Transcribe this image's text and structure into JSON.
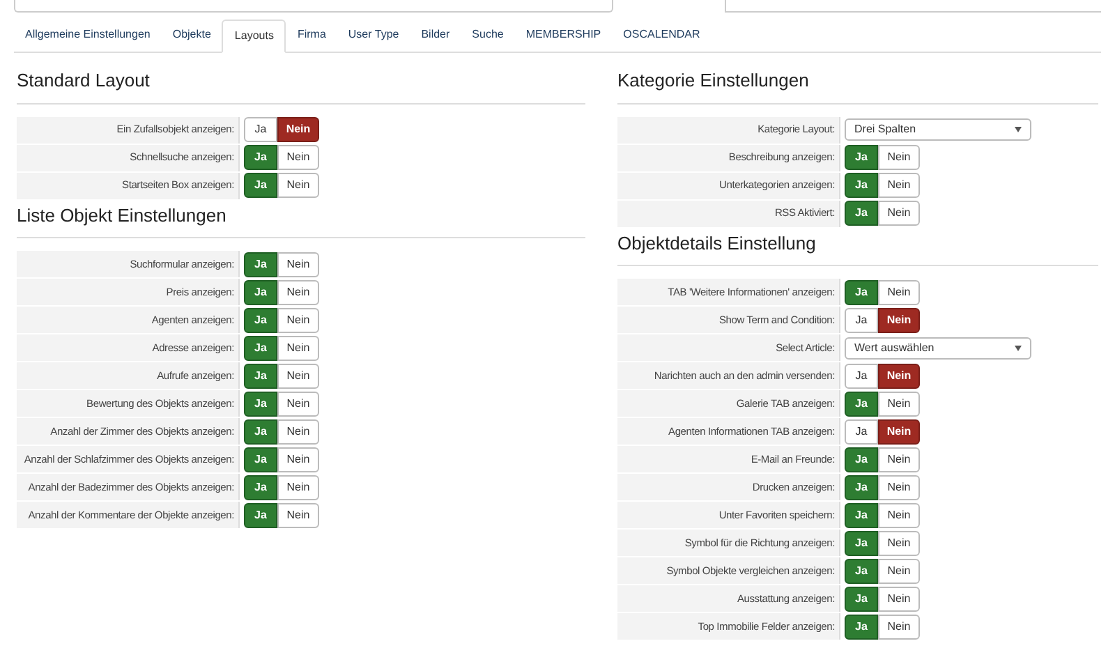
{
  "tabs": [
    {
      "label": "Allgemeine Einstellungen",
      "selected": false
    },
    {
      "label": "Objekte",
      "selected": false
    },
    {
      "label": "Layouts",
      "selected": true
    },
    {
      "label": "Firma",
      "selected": false
    },
    {
      "label": "User Type",
      "selected": false
    },
    {
      "label": "Bilder",
      "selected": false
    },
    {
      "label": "Suche",
      "selected": false
    },
    {
      "label": "MEMBERSHIP",
      "selected": false
    },
    {
      "label": "OSCALENDAR",
      "selected": false
    }
  ],
  "left": [
    {
      "title": "Standard Layout",
      "rows": [
        {
          "kind": "toggle",
          "label": "Ein Zufallsobjekt anzeigen:",
          "options": [
            {
              "label": "Ja",
              "selected": false
            },
            {
              "label": "Nein",
              "selected": true
            }
          ]
        },
        {
          "kind": "toggle",
          "label": "Schnellsuche anzeigen:",
          "options": [
            {
              "label": "Ja",
              "selected": true
            },
            {
              "label": "Nein",
              "selected": false
            }
          ]
        },
        {
          "kind": "toggle",
          "label": "Startseiten Box anzeigen:",
          "options": [
            {
              "label": "Ja",
              "selected": true
            },
            {
              "label": "Nein",
              "selected": false
            }
          ]
        }
      ]
    },
    {
      "title": "Liste Objekt Einstellungen",
      "rows": [
        {
          "kind": "toggle",
          "label": "Suchformular anzeigen:",
          "options": [
            {
              "label": "Ja",
              "selected": true
            },
            {
              "label": "Nein",
              "selected": false
            }
          ]
        },
        {
          "kind": "toggle",
          "label": "Preis anzeigen:",
          "options": [
            {
              "label": "Ja",
              "selected": true
            },
            {
              "label": "Nein",
              "selected": false
            }
          ]
        },
        {
          "kind": "toggle",
          "label": "Agenten anzeigen:",
          "options": [
            {
              "label": "Ja",
              "selected": true
            },
            {
              "label": "Nein",
              "selected": false
            }
          ]
        },
        {
          "kind": "toggle",
          "label": "Adresse anzeigen:",
          "options": [
            {
              "label": "Ja",
              "selected": true
            },
            {
              "label": "Nein",
              "selected": false
            }
          ]
        },
        {
          "kind": "toggle",
          "label": "Aufrufe anzeigen:",
          "options": [
            {
              "label": "Ja",
              "selected": true
            },
            {
              "label": "Nein",
              "selected": false
            }
          ]
        },
        {
          "kind": "toggle",
          "label": "Bewertung des Objekts anzeigen:",
          "options": [
            {
              "label": "Ja",
              "selected": true
            },
            {
              "label": "Nein",
              "selected": false
            }
          ]
        },
        {
          "kind": "toggle",
          "label": "Anzahl der Zimmer des Objekts anzeigen:",
          "options": [
            {
              "label": "Ja",
              "selected": true
            },
            {
              "label": "Nein",
              "selected": false
            }
          ]
        },
        {
          "kind": "toggle",
          "label": "Anzahl der Schlafzimmer des Objekts anzeigen:",
          "options": [
            {
              "label": "Ja",
              "selected": true
            },
            {
              "label": "Nein",
              "selected": false
            }
          ]
        },
        {
          "kind": "toggle",
          "label": "Anzahl der Badezimmer des Objekts anzeigen:",
          "options": [
            {
              "label": "Ja",
              "selected": true
            },
            {
              "label": "Nein",
              "selected": false
            }
          ]
        },
        {
          "kind": "toggle",
          "label": "Anzahl der Kommentare der Objekte anzeigen:",
          "options": [
            {
              "label": "Ja",
              "selected": true
            },
            {
              "label": "Nein",
              "selected": false
            }
          ]
        }
      ]
    }
  ],
  "right": [
    {
      "title": "Kategorie Einstellungen",
      "rows": [
        {
          "kind": "select",
          "label": "Kategorie Layout:",
          "value": "Drei Spalten"
        },
        {
          "kind": "toggle",
          "label": "Beschreibung anzeigen:",
          "options": [
            {
              "label": "Ja",
              "selected": true
            },
            {
              "label": "Nein",
              "selected": false
            }
          ]
        },
        {
          "kind": "toggle",
          "label": "Unterkategorien anzeigen:",
          "options": [
            {
              "label": "Ja",
              "selected": true
            },
            {
              "label": "Nein",
              "selected": false
            }
          ]
        },
        {
          "kind": "toggle",
          "label": "RSS Aktiviert:",
          "options": [
            {
              "label": "Ja",
              "selected": true
            },
            {
              "label": "Nein",
              "selected": false
            }
          ]
        }
      ]
    },
    {
      "title": "Objektdetails Einstellung",
      "rows": [
        {
          "kind": "toggle",
          "label": "TAB 'Weitere Informationen' anzeigen:",
          "options": [
            {
              "label": "Ja",
              "selected": true
            },
            {
              "label": "Nein",
              "selected": false
            }
          ]
        },
        {
          "kind": "toggle",
          "label": "Show Term and Condition:",
          "options": [
            {
              "label": "Ja",
              "selected": false
            },
            {
              "label": "Nein",
              "selected": true
            }
          ]
        },
        {
          "kind": "select",
          "label": "Select Article:",
          "value": "Wert auswählen"
        },
        {
          "kind": "toggle",
          "label": "Narichten auch an den admin versenden:",
          "options": [
            {
              "label": "Ja",
              "selected": false
            },
            {
              "label": "Nein",
              "selected": true
            }
          ]
        },
        {
          "kind": "toggle",
          "label": "Galerie TAB anzeigen:",
          "options": [
            {
              "label": "Ja",
              "selected": true
            },
            {
              "label": "Nein",
              "selected": false
            }
          ]
        },
        {
          "kind": "toggle",
          "label": "Agenten Informationen TAB anzeigen:",
          "options": [
            {
              "label": "Ja",
              "selected": false
            },
            {
              "label": "Nein",
              "selected": true
            }
          ]
        },
        {
          "kind": "toggle",
          "label": "E-Mail an Freunde:",
          "options": [
            {
              "label": "Ja",
              "selected": true
            },
            {
              "label": "Nein",
              "selected": false
            }
          ]
        },
        {
          "kind": "toggle",
          "label": "Drucken anzeigen:",
          "options": [
            {
              "label": "Ja",
              "selected": true
            },
            {
              "label": "Nein",
              "selected": false
            }
          ]
        },
        {
          "kind": "toggle",
          "label": "Unter Favoriten speichern:",
          "options": [
            {
              "label": "Ja",
              "selected": true
            },
            {
              "label": "Nein",
              "selected": false
            }
          ]
        },
        {
          "kind": "toggle",
          "label": "Symbol für die Richtung anzeigen:",
          "options": [
            {
              "label": "Ja",
              "selected": true
            },
            {
              "label": "Nein",
              "selected": false
            }
          ]
        },
        {
          "kind": "toggle",
          "label": "Symbol Objekte vergleichen anzeigen:",
          "options": [
            {
              "label": "Ja",
              "selected": true
            },
            {
              "label": "Nein",
              "selected": false
            }
          ]
        },
        {
          "kind": "toggle",
          "label": "Ausstattung anzeigen:",
          "options": [
            {
              "label": "Ja",
              "selected": true
            },
            {
              "label": "Nein",
              "selected": false
            }
          ]
        },
        {
          "kind": "toggle",
          "label": "Top Immobilie Felder anzeigen:",
          "options": [
            {
              "label": "Ja",
              "selected": true
            },
            {
              "label": "Nein",
              "selected": false
            }
          ]
        }
      ]
    }
  ]
}
